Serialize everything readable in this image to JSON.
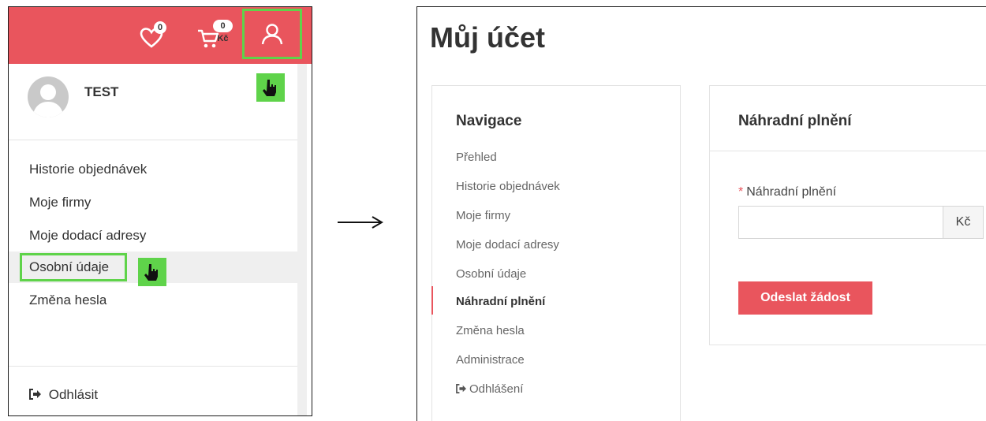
{
  "colors": {
    "accent": "#e9555d",
    "highlight": "#5fd34a"
  },
  "left": {
    "wishlist": {
      "icon": "heart-icon",
      "count": "0"
    },
    "cart": {
      "icon": "cart-icon",
      "amount": "0 Kč"
    },
    "user_button_icon": "user-icon",
    "user": {
      "name": "TEST",
      "avatar_icon": "avatar-placeholder"
    },
    "menu": [
      {
        "label": "Historie objednávek"
      },
      {
        "label": "Moje firmy"
      },
      {
        "label": "Moje dodací adresy"
      },
      {
        "label": "Osobní údaje"
      },
      {
        "label": "Změna hesla"
      }
    ],
    "logout": {
      "icon": "sign-out-icon",
      "label": "Odhlásit"
    },
    "pointer_icon": "hand-pointer-icon"
  },
  "arrow": {
    "glyph": "⟶"
  },
  "right": {
    "page_title": "Můj účet",
    "nav": {
      "heading": "Navigace",
      "items": [
        {
          "label": "Přehled"
        },
        {
          "label": "Historie objednávek"
        },
        {
          "label": "Moje firmy"
        },
        {
          "label": "Moje dodací adresy"
        },
        {
          "label": "Osobní údaje"
        },
        {
          "label": "Náhradní plnění",
          "active": true
        },
        {
          "label": "Změna hesla"
        },
        {
          "label": "Administrace"
        },
        {
          "label": "Odhlášení",
          "icon": "sign-out-icon"
        }
      ]
    },
    "form": {
      "heading": "Náhradní plnění",
      "required_mark": "*",
      "field_label": "Náhradní plnění",
      "field_value": "",
      "currency": "Kč",
      "submit_label": "Odeslat žádost"
    }
  }
}
